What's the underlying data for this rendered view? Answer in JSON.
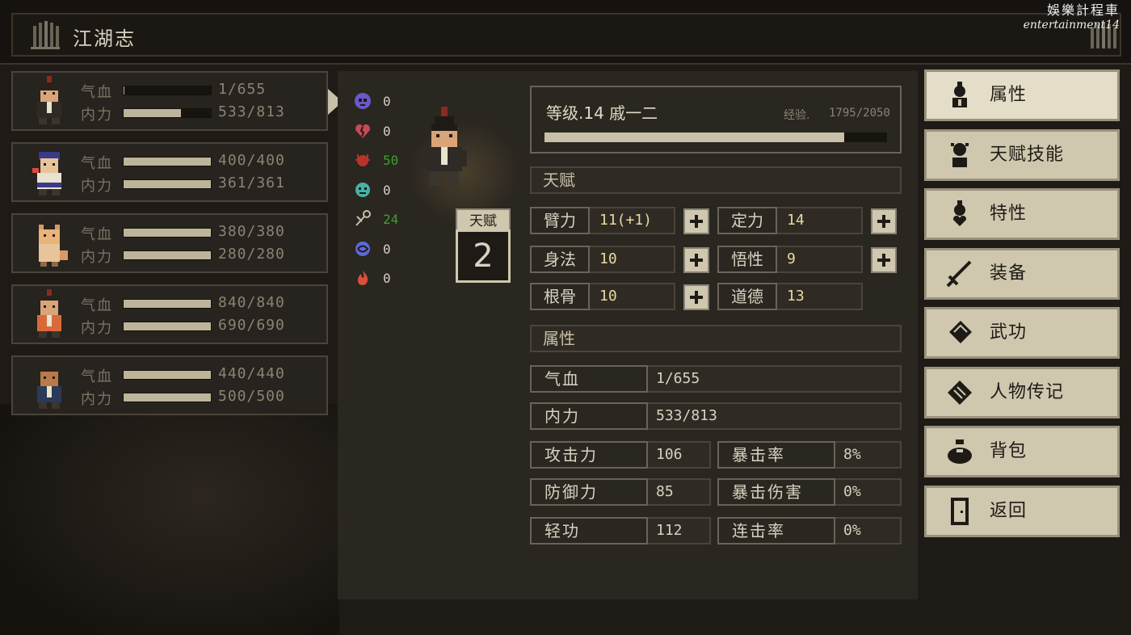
{
  "header": {
    "title": "江湖志"
  },
  "watermark": {
    "line1": "娛樂計程車",
    "line2": "entertainment14"
  },
  "party": [
    {
      "hp_label": "气血",
      "hp_value": "1/655",
      "hp_fill": 0.0015,
      "mp_label": "内力",
      "mp_value": "533/813",
      "mp_fill": 0.656,
      "selected": true
    },
    {
      "hp_label": "气血",
      "hp_value": "400/400",
      "hp_fill": 1,
      "mp_label": "内力",
      "mp_value": "361/361",
      "mp_fill": 1
    },
    {
      "hp_label": "气血",
      "hp_value": "380/380",
      "hp_fill": 1,
      "mp_label": "内力",
      "mp_value": "280/280",
      "mp_fill": 1
    },
    {
      "hp_label": "气血",
      "hp_value": "840/840",
      "hp_fill": 1,
      "mp_label": "内力",
      "mp_value": "690/690",
      "mp_fill": 1
    },
    {
      "hp_label": "气血",
      "hp_value": "440/440",
      "hp_fill": 1,
      "mp_label": "内力",
      "mp_value": "500/500",
      "mp_fill": 1
    }
  ],
  "resistances": [
    {
      "icon": "skull-icon",
      "color": "#6a58c8",
      "value": "0"
    },
    {
      "icon": "broken-heart-icon",
      "color": "#c84a52",
      "value": "0"
    },
    {
      "icon": "bug-icon",
      "color": "#b83228",
      "value": "50",
      "green": true
    },
    {
      "icon": "ghost-icon",
      "color": "#48b0a8",
      "value": "0"
    },
    {
      "icon": "needle-icon",
      "color": "#c8c0a8",
      "value": "24",
      "green": true
    },
    {
      "icon": "swirl-icon",
      "color": "#5a6ad8",
      "value": "0"
    },
    {
      "icon": "fire-icon",
      "color": "#d8503a",
      "value": "0"
    }
  ],
  "talent_points": {
    "label": "天赋",
    "value": "2"
  },
  "character": {
    "level_text": "等级.14  戚一二",
    "exp_label": "经验.",
    "exp_value": "1795/2050",
    "exp_fill": 0.8756
  },
  "talent_section": {
    "title": "天赋",
    "stats": [
      {
        "label": "臂力",
        "value": "11(+1)"
      },
      {
        "label": "定力",
        "value": "14"
      },
      {
        "label": "身法",
        "value": "10"
      },
      {
        "label": "悟性",
        "value": "9"
      },
      {
        "label": "根骨",
        "value": "10"
      },
      {
        "label": "道德",
        "value": "13"
      }
    ]
  },
  "attr_section": {
    "title": "属性",
    "hp": {
      "label": "气血",
      "value": "1/655"
    },
    "mp": {
      "label": "内力",
      "value": "533/813"
    },
    "attack": {
      "label": "攻击力",
      "value": "106"
    },
    "crit": {
      "label": "暴击率",
      "value": "8%"
    },
    "defense": {
      "label": "防御力",
      "value": "85"
    },
    "crit_dmg": {
      "label": "暴击伤害",
      "value": "0%"
    },
    "agility": {
      "label": "轻功",
      "value": "112"
    },
    "combo": {
      "label": "连击率",
      "value": "0%"
    }
  },
  "menu": [
    {
      "label": "属性",
      "icon": "person-icon",
      "active": true
    },
    {
      "label": "天赋技能",
      "icon": "talent-person-icon"
    },
    {
      "label": "特性",
      "icon": "trait-person-icon"
    },
    {
      "label": "装备",
      "icon": "sword-icon"
    },
    {
      "label": "武功",
      "icon": "book-icon"
    },
    {
      "label": "人物传记",
      "icon": "scroll-icon"
    },
    {
      "label": "背包",
      "icon": "bag-icon"
    },
    {
      "label": "返回",
      "icon": "door-icon"
    }
  ]
}
